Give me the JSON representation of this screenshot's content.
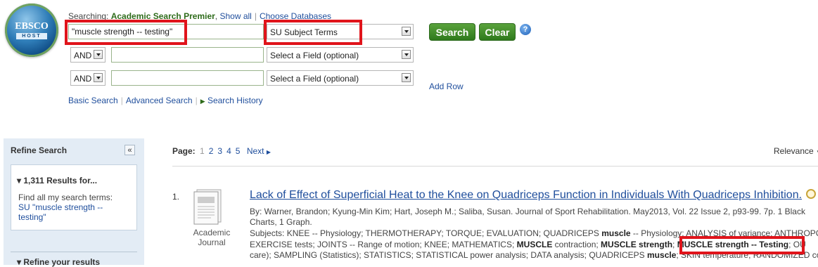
{
  "logo": {
    "text_top": "EBSCO",
    "text_bottom": "HOST"
  },
  "searching": {
    "prefix": "Searching: ",
    "database": "Academic Search Premier",
    "show_all": "Show all",
    "choose_db": "Choose Databases"
  },
  "search_rows": [
    {
      "boolean": "",
      "term": "\"muscle strength -- testing\"",
      "field": "SU Subject Terms"
    },
    {
      "boolean": "AND",
      "term": "",
      "field": "Select a Field (optional)"
    },
    {
      "boolean": "AND",
      "term": "",
      "field": "Select a Field (optional)"
    }
  ],
  "buttons": {
    "search": "Search",
    "clear": "Clear",
    "help": "?",
    "add_row": "Add Row"
  },
  "links": {
    "basic": "Basic Search",
    "advanced": "Advanced Search",
    "history": "Search History"
  },
  "refine": {
    "title": "Refine Search",
    "collapse": "«",
    "results_count": "1,311 Results for...",
    "find_all": "Find all my search terms:",
    "term": "SU \"muscle strength -- testing\"",
    "refine_results": "Refine your results"
  },
  "pager": {
    "label": "Page:",
    "pages": [
      "1",
      "2",
      "3",
      "4",
      "5"
    ],
    "next": "Next",
    "sort": "Relevance"
  },
  "result": {
    "number": "1.",
    "pub_type_1": "Academic",
    "pub_type_2": "Journal",
    "title": "Lack of Effect of Superficial Heat to the Knee on Quadriceps Function in Individuals With Quadriceps Inhibition.",
    "meta_line1": "By: Warner, Brandon; Kyung-Min Kim; Hart, Joseph M.; Saliba, Susan. Journal of Sport Rehabilitation. May2013, Vol. 22 Issue 2, p93-99. 7p. 1 Black",
    "meta_line2": "Charts, 1 Graph.",
    "subjects_1a": "Subjects: KNEE -- Physiology; THERMOTHERAPY; TORQUE; EVALUATION; QUADRICEPS ",
    "subjects_1b": "muscle",
    "subjects_1c": " -- Physiology; ANALYSIS of variance; ANTHROPOM",
    "subjects_2a": "EXERCISE tests; JOINTS -- Range of motion; KNEE; MATHEMATICS; ",
    "subjects_2b": "MUSCLE",
    "subjects_2c": " contraction; ",
    "subjects_2d": "MUSCLE strength",
    "subjects_2e": "; ",
    "subjects_2f": "MUSCLE strength -- Testing",
    "subjects_2g": "; OU",
    "subjects_3a": "care); SAMPLING (Statistics); STATISTICS; STATISTICAL power analysis; DATA analysis; QUADRICEPS ",
    "subjects_3b": "muscle",
    "subjects_3c": "; SKIN temperature; RANDOMIZED co"
  }
}
